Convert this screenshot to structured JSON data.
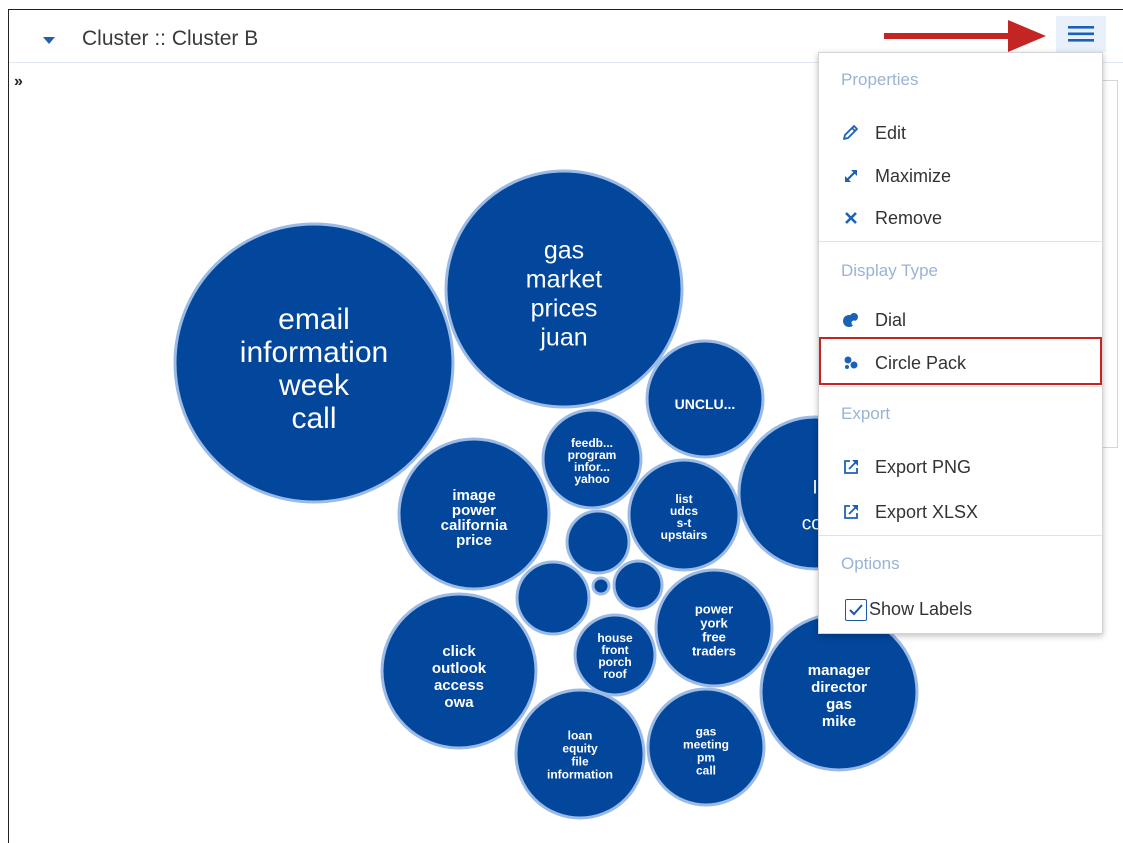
{
  "header": {
    "title": "Cluster :: Cluster B",
    "expand_glyph": "»"
  },
  "colors": {
    "bubble": "#02479b",
    "bubble_stroke": "#9bbbe6",
    "accent": "#1a62b7",
    "highlight": "#c32525"
  },
  "icons": {
    "collapse": "caret-down-icon",
    "menu": "hamburger-icon",
    "pointer": "red-arrow-icon"
  },
  "menu": {
    "sections": [
      {
        "header": "Properties",
        "items": [
          {
            "label": "Edit",
            "icon": "pencil-icon"
          },
          {
            "label": "Maximize",
            "icon": "maximize-icon"
          },
          {
            "label": "Remove",
            "icon": "close-icon"
          }
        ]
      },
      {
        "header": "Display Type",
        "items": [
          {
            "label": "Dial",
            "icon": "dial-icon"
          },
          {
            "label": "Circle Pack",
            "icon": "circle-pack-icon",
            "selected": true
          }
        ]
      },
      {
        "header": "Export",
        "items": [
          {
            "label": "Export PNG",
            "icon": "export-icon"
          },
          {
            "label": "Export XLSX",
            "icon": "export-icon"
          }
        ]
      },
      {
        "header": "Options",
        "items": [
          {
            "label": "Show Labels",
            "icon": "checkbox-icon",
            "checked": true
          }
        ]
      }
    ]
  },
  "bubbles": [
    {
      "words": [
        "email",
        "information",
        "week",
        "call"
      ]
    },
    {
      "words": [
        "gas",
        "market",
        "prices",
        "juan"
      ]
    },
    {
      "words": [
        "UNCLU..."
      ]
    },
    {
      "words": [
        "feedb...",
        "program",
        "infor...",
        "yahoo"
      ]
    },
    {
      "words": [
        "image",
        "power",
        "california",
        "price"
      ]
    },
    {
      "words": [
        "list",
        "udcs",
        "s-t",
        "upstairs"
      ]
    },
    {
      "words": [
        "I",
        "cor"
      ]
    },
    {
      "words": []
    },
    {
      "words": []
    },
    {
      "words": []
    },
    {
      "words": []
    },
    {
      "words": [
        "power",
        "york",
        "free",
        "traders"
      ]
    },
    {
      "words": [
        "house",
        "front",
        "porch",
        "roof"
      ]
    },
    {
      "words": [
        "click",
        "outlook",
        "access",
        "owa"
      ]
    },
    {
      "words": [
        "manager",
        "director",
        "gas",
        "mike"
      ]
    },
    {
      "words": [
        "loan",
        "equity",
        "file",
        "information"
      ]
    },
    {
      "words": [
        "gas",
        "meeting",
        "pm",
        "call"
      ]
    }
  ]
}
